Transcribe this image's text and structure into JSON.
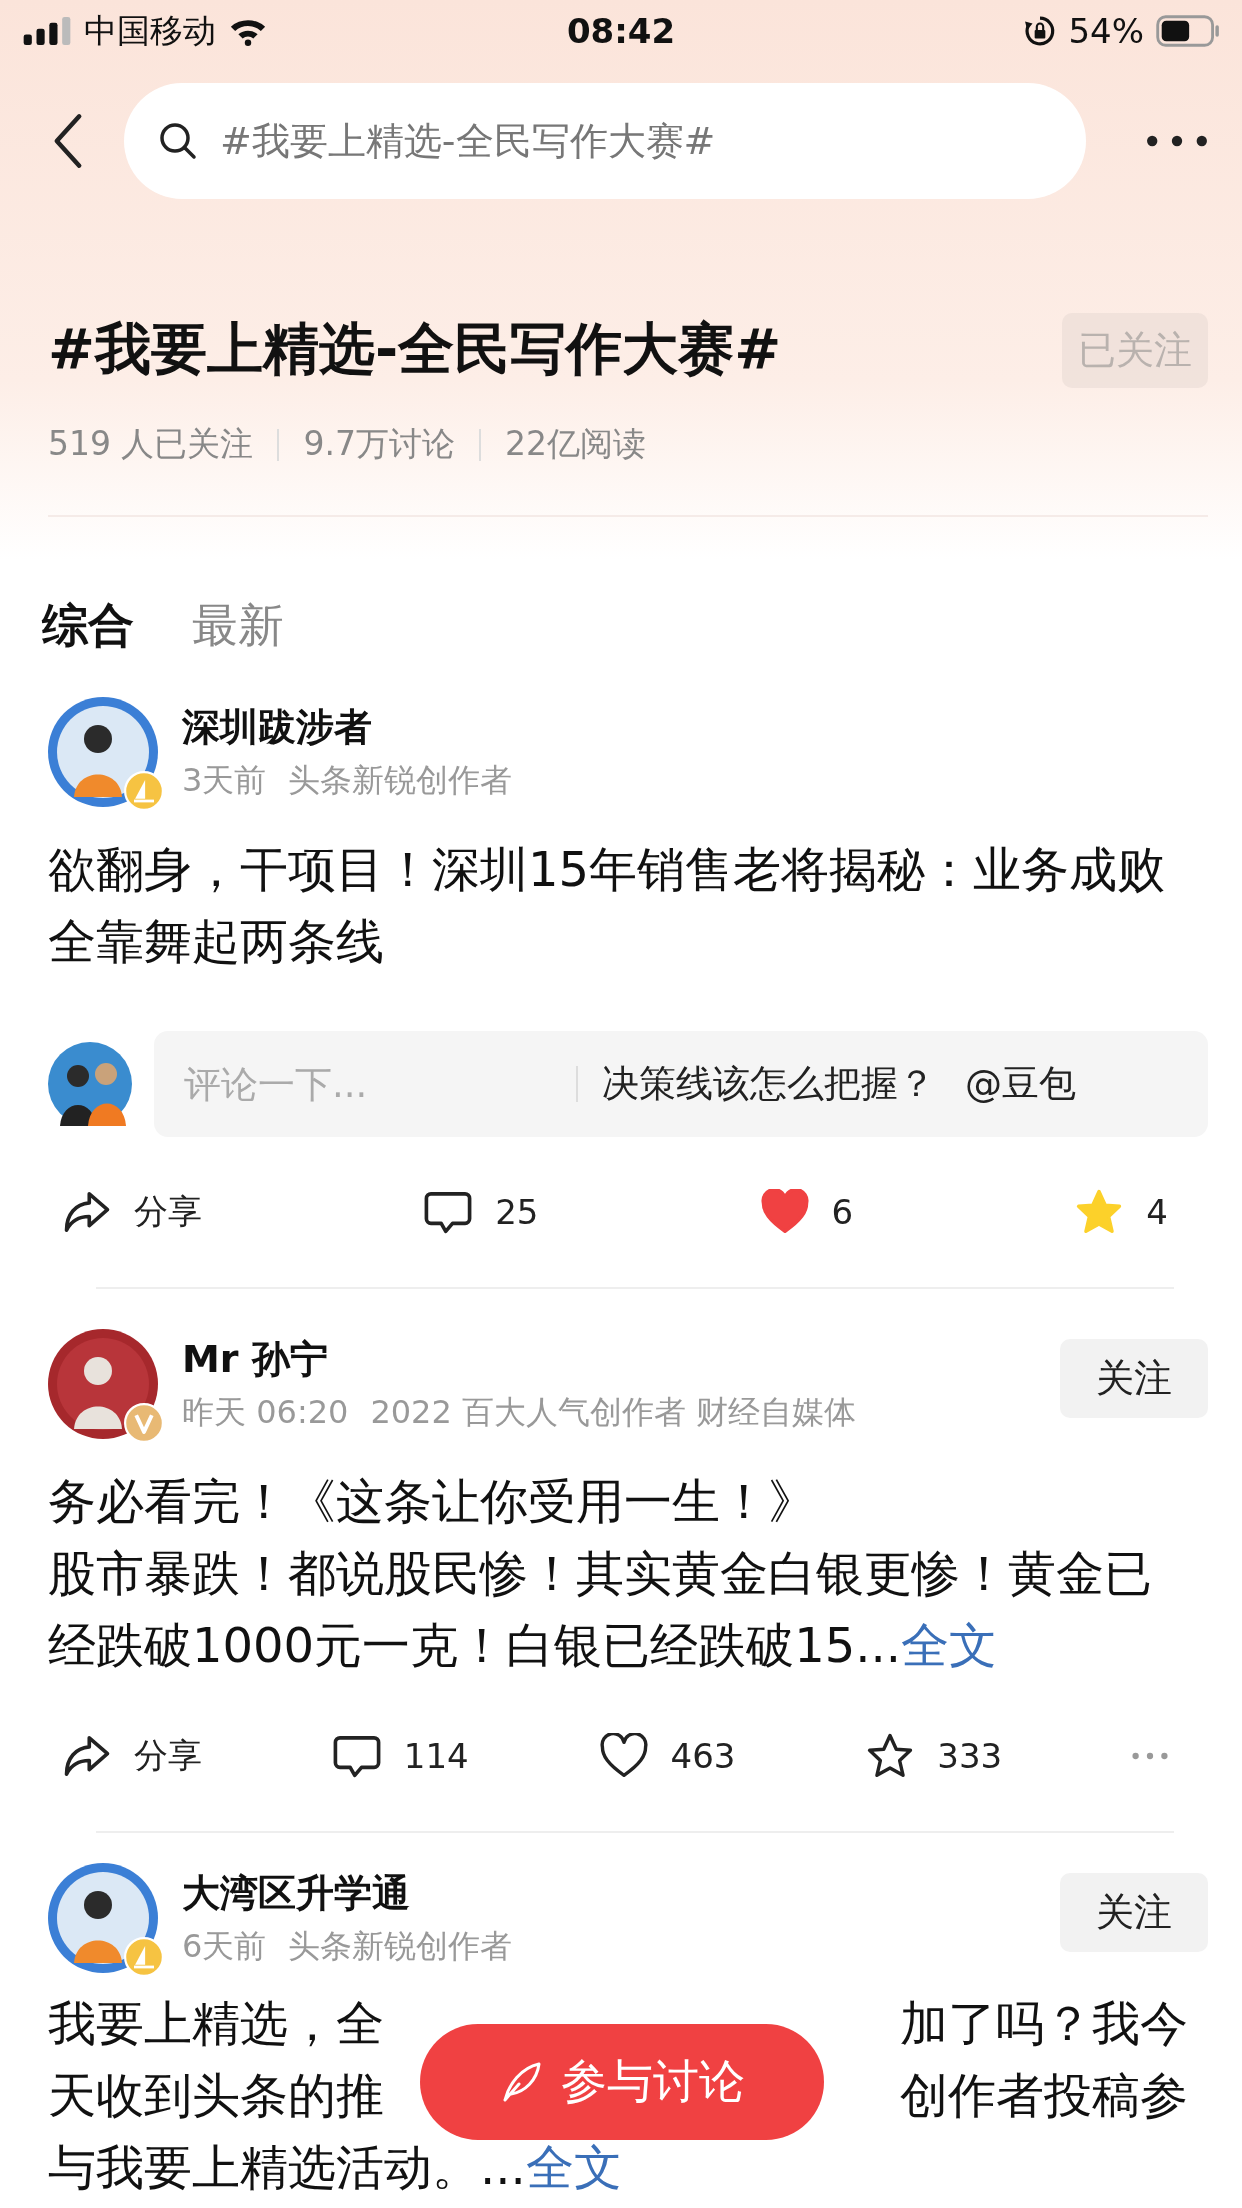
{
  "status_bar": {
    "carrier": "中国移动",
    "time": "08:42",
    "battery": "54%"
  },
  "search": {
    "placeholder": "#我要上精选-全民写作大赛#"
  },
  "topic": {
    "title": "#我要上精选-全民写作大赛#",
    "follow": {
      "label": "已关注",
      "followed": true
    },
    "stats": [
      "519 人已关注",
      "9.7万讨论",
      "22亿阅读"
    ]
  },
  "tabs": [
    {
      "label": "综合",
      "selected": true
    },
    {
      "label": "最新",
      "selected": false
    }
  ],
  "posts": [
    {
      "kind": "full",
      "author": "深圳跋涉者",
      "time": "3天前",
      "tag": "头条新锐创作者",
      "badge": {
        "kind": "creator"
      },
      "paragraphs": [
        "欲翻身，干项目！深圳15年销售老将揭秘：业务成败全靠舞起两条线"
      ],
      "comment": {
        "placeholder": "评论一下...",
        "suggestion": "决策线该怎么把握？",
        "mention": "@豆包"
      },
      "actions": [
        {
          "kind": "share",
          "label": "分享"
        },
        {
          "kind": "comment",
          "label": "25"
        },
        {
          "kind": "like",
          "label": "6",
          "active": true
        },
        {
          "kind": "favorite",
          "label": "4",
          "active": true
        }
      ]
    },
    {
      "kind": "full",
      "author": "Mr 孙宁",
      "time": "昨天 06:20",
      "tag": "2022 百大人气创作者 财经自媒体",
      "badge": {
        "kind": "verified"
      },
      "follow": "关注",
      "paragraphs": [
        "务必看完！《这条让你受用一生！》",
        "股市暴跌！都说股民惨！其实黄金白银更惨！黄金已经跌破1000元一克！白银已经跌破15..."
      ],
      "more": "全文",
      "actions": [
        {
          "kind": "share",
          "label": "分享"
        },
        {
          "kind": "comment",
          "label": "114"
        },
        {
          "kind": "like",
          "label": "463",
          "active": false
        },
        {
          "kind": "favorite",
          "label": "333",
          "active": false
        }
      ],
      "menu": true
    },
    {
      "kind": "covered",
      "author": "大湾区升学通",
      "time": "6天前",
      "tag": "头条新锐创作者",
      "badge": {
        "kind": "creator"
      },
      "follow": "关注",
      "lines": [
        {
          "left": "我要上精选，全",
          "right": "加了吗？我今"
        },
        {
          "left": "天收到头条的推",
          "right": "创作者投稿参"
        }
      ],
      "last_line": "与我要上精选活动。...",
      "more": "全文"
    }
  ],
  "fab": {
    "label": "参与讨论"
  }
}
